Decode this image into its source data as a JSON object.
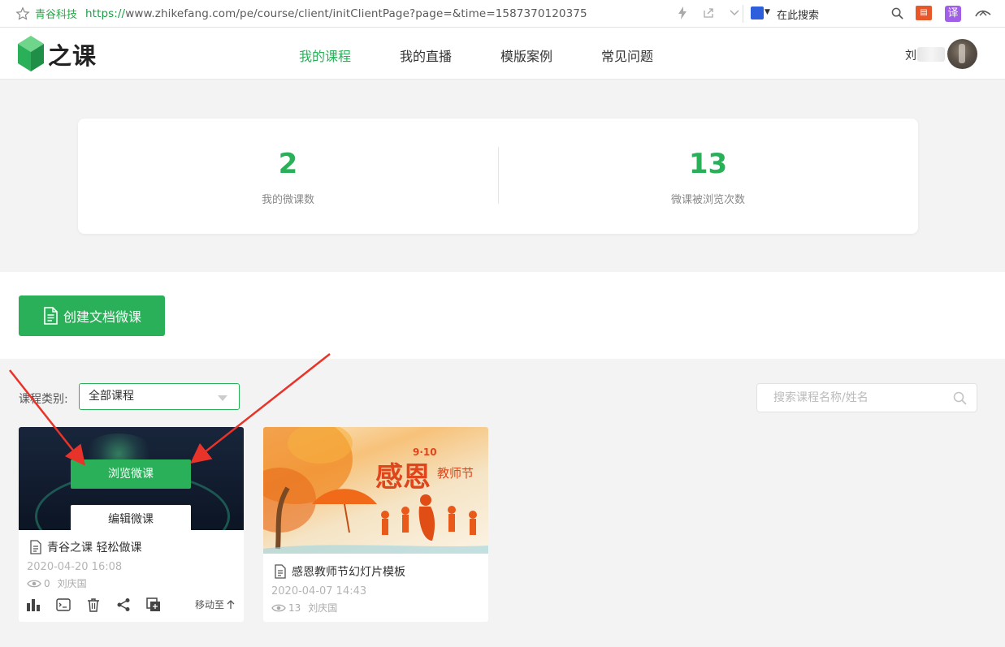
{
  "browser": {
    "site_name": "青谷科技",
    "url_scheme": "https://",
    "url_rest": "www.zhikefang.com/pe/course/client/initClientPage?page=&time=1587370120375",
    "search_placeholder": "在此搜索",
    "translate_label": "译"
  },
  "header": {
    "logo_text": "之课",
    "nav": [
      {
        "label": "我的课程",
        "active": true
      },
      {
        "label": "我的直播",
        "active": false
      },
      {
        "label": "模版案例",
        "active": false
      },
      {
        "label": "常见问题",
        "active": false
      }
    ],
    "user_name": "刘"
  },
  "stats": [
    {
      "value": "2",
      "label": "我的微课数"
    },
    {
      "value": "13",
      "label": "微课被浏览次数"
    }
  ],
  "create_button": "创建文档微课",
  "filter": {
    "label": "课程类别:",
    "selected": "全部课程",
    "search_placeholder": "搜索课程名称/姓名"
  },
  "courses": [
    {
      "title": "青谷之课 轻松做课",
      "date": "2020-04-20 16:08",
      "views": "0",
      "author": "刘庆国",
      "browse_label": "浏览微课",
      "edit_label": "编辑微课",
      "move_label": "移动至"
    },
    {
      "title": "感恩教师节幻灯片模板",
      "date": "2020-04-07 14:43",
      "views": "13",
      "author": "刘庆国",
      "thumb_text_big": "感恩",
      "thumb_text_small": "教师节",
      "thumb_date": "9·10"
    }
  ],
  "colors": {
    "accent": "#2bb05a",
    "arrow": "#e8332a"
  }
}
